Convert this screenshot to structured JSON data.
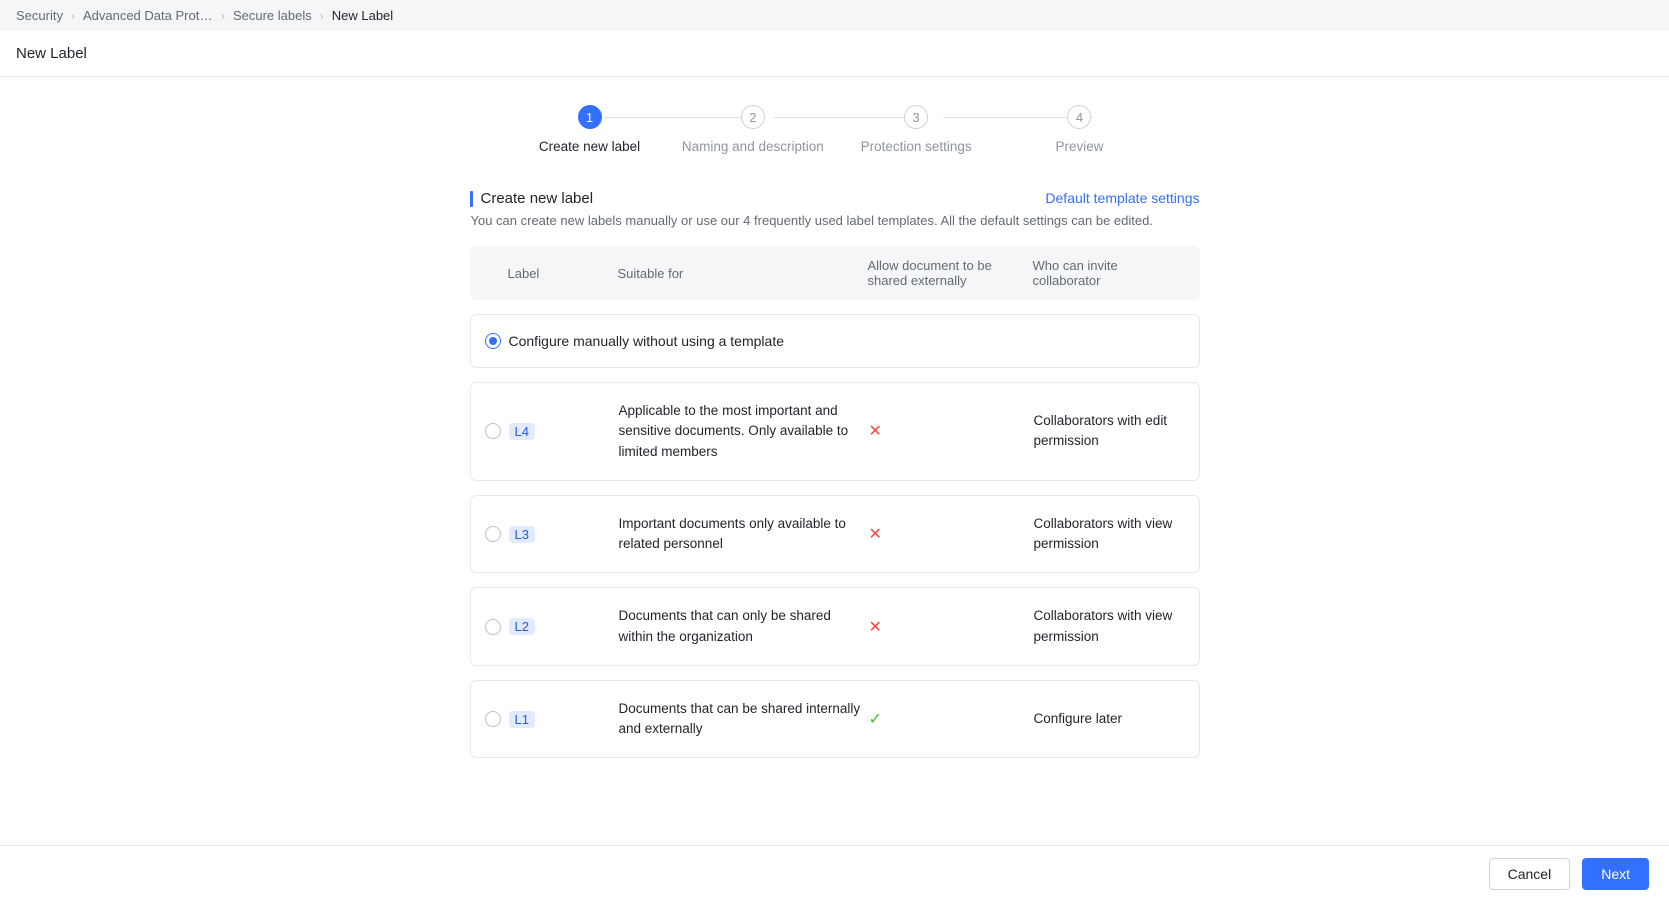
{
  "breadcrumb": {
    "items": [
      "Security",
      "Advanced Data Prote…",
      "Secure labels",
      "New Label"
    ]
  },
  "page_title": "New Label",
  "stepper": {
    "active_index": 0,
    "steps": [
      {
        "num": "1",
        "label": "Create new label"
      },
      {
        "num": "2",
        "label": "Naming and description"
      },
      {
        "num": "3",
        "label": "Protection settings"
      },
      {
        "num": "4",
        "label": "Preview"
      }
    ]
  },
  "section": {
    "title": "Create new label",
    "link": "Default template settings",
    "description": "You can create new labels manually or use our 4 frequently used label templates. All the default settings can be edited."
  },
  "table_header": {
    "label": "Label",
    "suitable": "Suitable for",
    "share": "Allow document to be shared externally",
    "invite": "Who can invite collaborator"
  },
  "options": {
    "manual_label": "Configure manually without using a template",
    "selected": "manual",
    "templates": [
      {
        "badge": "L4",
        "suitable": "Applicable to the most important and sensitive documents. Only available to limited members",
        "share": false,
        "invite": "Collaborators with edit permission"
      },
      {
        "badge": "L3",
        "suitable": "Important documents only available to related personnel",
        "share": false,
        "invite": "Collaborators with view permission"
      },
      {
        "badge": "L2",
        "suitable": "Documents that can only be shared within the organization",
        "share": false,
        "invite": "Collaborators with view permission"
      },
      {
        "badge": "L1",
        "suitable": "Documents that can be shared internally and externally",
        "share": true,
        "invite": "Configure later"
      }
    ]
  },
  "footer": {
    "cancel": "Cancel",
    "next": "Next"
  }
}
